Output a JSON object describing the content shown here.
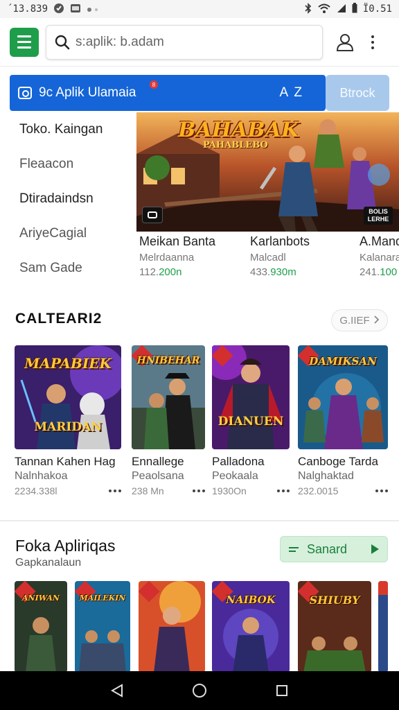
{
  "status_bar": {
    "time": "´13.839",
    "clock": "Ï0.51"
  },
  "search": {
    "placeholder": "s:aplik: b.adam"
  },
  "banner": {
    "title": "9c Aplik Ulamaia",
    "badge": "8",
    "sort_label": "A Z",
    "button_label": "Btrock",
    "color": "#1565d8"
  },
  "side_menu": {
    "items": [
      {
        "label": "Toko. Kaingan"
      },
      {
        "label": "Fleaacon"
      },
      {
        "label": "Dtiradaindsn"
      },
      {
        "label": "AriyeCagial"
      },
      {
        "label": "Sam Gade"
      }
    ]
  },
  "hero": {
    "title": "BAHABAK",
    "subtitle": "PAHABLEBO",
    "badge_text": "BOLIS LERHE",
    "captions": [
      {
        "title": "Meikan Banta",
        "subtitle": "Melrdaanna",
        "meta_prefix": "112.",
        "meta_green": "200n"
      },
      {
        "title": "Karlanbots",
        "subtitle": "Malcadl",
        "meta_prefix": "433.",
        "meta_green": "930m"
      },
      {
        "title": "A.Mand",
        "subtitle": "Kalanara",
        "meta_prefix": "241.",
        "meta_green": "100"
      }
    ]
  },
  "section1": {
    "title": "CALTEARI2",
    "more_label": "G.IIEF",
    "cards": [
      {
        "art_title": "MAPABIEK",
        "art_title2": "MARIDAN",
        "title": "Tannan Kahen Hag",
        "subtitle": "Nalnhakoa",
        "meta": "2234.338l"
      },
      {
        "art_title": "HNIBEHAR",
        "art_title2": "",
        "title": "Ennallege",
        "subtitle": "Peaolsana",
        "meta": "238 Mn"
      },
      {
        "art_title": "",
        "art_title2": "DIANUEN",
        "title": "Palladona",
        "subtitle": "Peokaala",
        "meta": "1930On"
      },
      {
        "art_title": "DAMIKSAN",
        "art_title2": "",
        "title": "Canboge Tarda",
        "subtitle": "Nalghaktad",
        "meta": "232.0015"
      }
    ]
  },
  "section2": {
    "title": "Foka Apliriqas",
    "subtitle": "Gapkanalaun",
    "button_label": "Sanard",
    "items": [
      {
        "art_title": "ANIWAN"
      },
      {
        "art_title": "MAILEKIN"
      },
      {
        "art_title": ""
      },
      {
        "art_title": "NAIBOK"
      },
      {
        "art_title": "SHIUBY"
      },
      {
        "art_title": ""
      }
    ]
  },
  "icons": {
    "menu": "hamburger-icon",
    "search": "search-icon",
    "account": "person-icon",
    "more": "more-vert-icon",
    "nav_back": "back-triangle-icon",
    "nav_home": "home-circle-icon",
    "nav_recents": "recents-square-icon"
  },
  "colors": {
    "accent_green": "#1e9e4a",
    "banner_blue": "#1565d8",
    "button_light_blue": "#a9c9ec"
  }
}
